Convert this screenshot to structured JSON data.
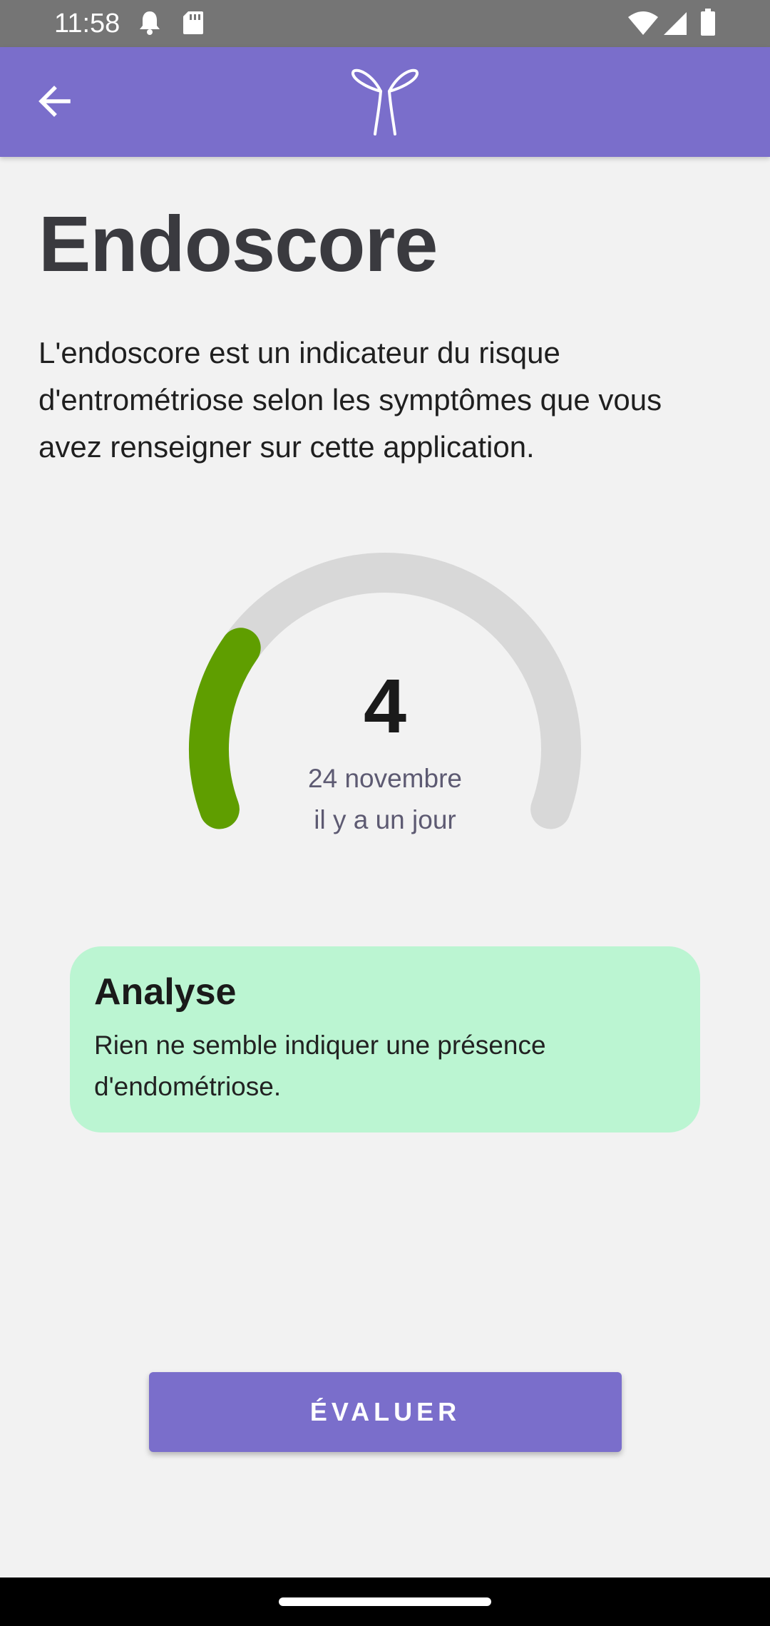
{
  "status_bar": {
    "time": "11:58",
    "icons": [
      "notification-bell-icon",
      "sd-card-icon",
      "wifi-icon",
      "signal-icon",
      "battery-icon"
    ]
  },
  "app_bar": {
    "background": "#7a6ecb",
    "back_icon": "arrow-left-icon",
    "logo_icon": "ribbon-logo-icon"
  },
  "page": {
    "title": "Endoscore",
    "description": "L'endoscore est un indicateur du risque d'entrométriose selon les symptômes que vous avez renseigner sur cette application."
  },
  "gauge": {
    "score": "4",
    "score_value": 4,
    "fill_fraction": 0.25,
    "date": "24 novembre",
    "relative_time": "il y a un jour",
    "fill_color": "#5f9e00",
    "track_color": "#d8d8d8"
  },
  "analysis": {
    "title": "Analyse",
    "text": "Rien ne semble indiquer une présence d'endométriose.",
    "background": "#bbf5d2"
  },
  "actions": {
    "evaluate_label": "ÉVALUER",
    "accent": "#7a6ecb"
  }
}
